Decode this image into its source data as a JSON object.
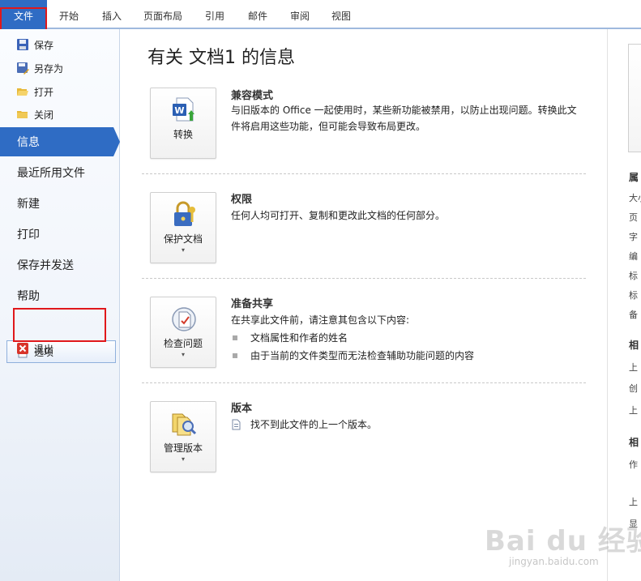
{
  "ribbon": {
    "tabs": [
      "文件",
      "开始",
      "插入",
      "页面布局",
      "引用",
      "邮件",
      "审阅",
      "视图"
    ]
  },
  "sidebar": {
    "commands": [
      {
        "label": "保存",
        "icon": "save-icon"
      },
      {
        "label": "另存为",
        "icon": "save-as-icon"
      },
      {
        "label": "打开",
        "icon": "open-folder-icon"
      },
      {
        "label": "关闭",
        "icon": "close-folder-icon"
      }
    ],
    "nav": [
      "信息",
      "最近所用文件",
      "新建",
      "打印",
      "保存并发送",
      "帮助"
    ],
    "options_label": "选项",
    "exit_label": "退出"
  },
  "main": {
    "title": "有关 文档1 的信息",
    "compat": {
      "button_label": "转换",
      "title": "兼容模式",
      "desc": "与旧版本的 Office 一起使用时，某些新功能被禁用，以防止出现问题。转换此文件将启用这些功能，但可能会导致布局更改。"
    },
    "permissions": {
      "button_label": "保护文档",
      "button_arrow": "▾",
      "title": "权限",
      "desc": "任何人均可打开、复制和更改此文档的任何部分。"
    },
    "share": {
      "button_label": "检查问题",
      "button_arrow": "▾",
      "title": "准备共享",
      "desc": "在共享此文件前，请注意其包含以下内容:",
      "bullets": [
        "文档属性和作者的姓名",
        "由于当前的文件类型而无法检查辅助功能问题的内容"
      ]
    },
    "versions": {
      "button_label": "管理版本",
      "button_arrow": "▾",
      "title": "版本",
      "desc": "找不到此文件的上一个版本。"
    }
  },
  "rightpane": {
    "props": [
      "属",
      "大小",
      "页",
      "字",
      "编",
      "标",
      "标",
      "备",
      "相",
      "上",
      "创",
      "上",
      "相",
      "作",
      "上",
      "显"
    ]
  },
  "watermark": {
    "logo": "Bai du 经验",
    "url": "jingyan.baidu.com"
  },
  "colors": {
    "accent": "#2f6cc4",
    "highlight_box": "#e0181b"
  }
}
